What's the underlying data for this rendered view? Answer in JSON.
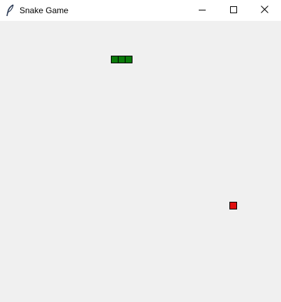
{
  "window": {
    "title": "Snake Game",
    "icon": "feather-icon",
    "controls": [
      "minimize-icon",
      "maximize-icon",
      "close-icon"
    ]
  },
  "game": {
    "grid_cell": 10,
    "snake": {
      "color": "#0a7a0a",
      "segments": [
        [
          16,
          5
        ],
        [
          17,
          5
        ],
        [
          18,
          5
        ]
      ]
    },
    "food": {
      "color": "#e01010",
      "position": [
        33,
        26
      ]
    }
  }
}
